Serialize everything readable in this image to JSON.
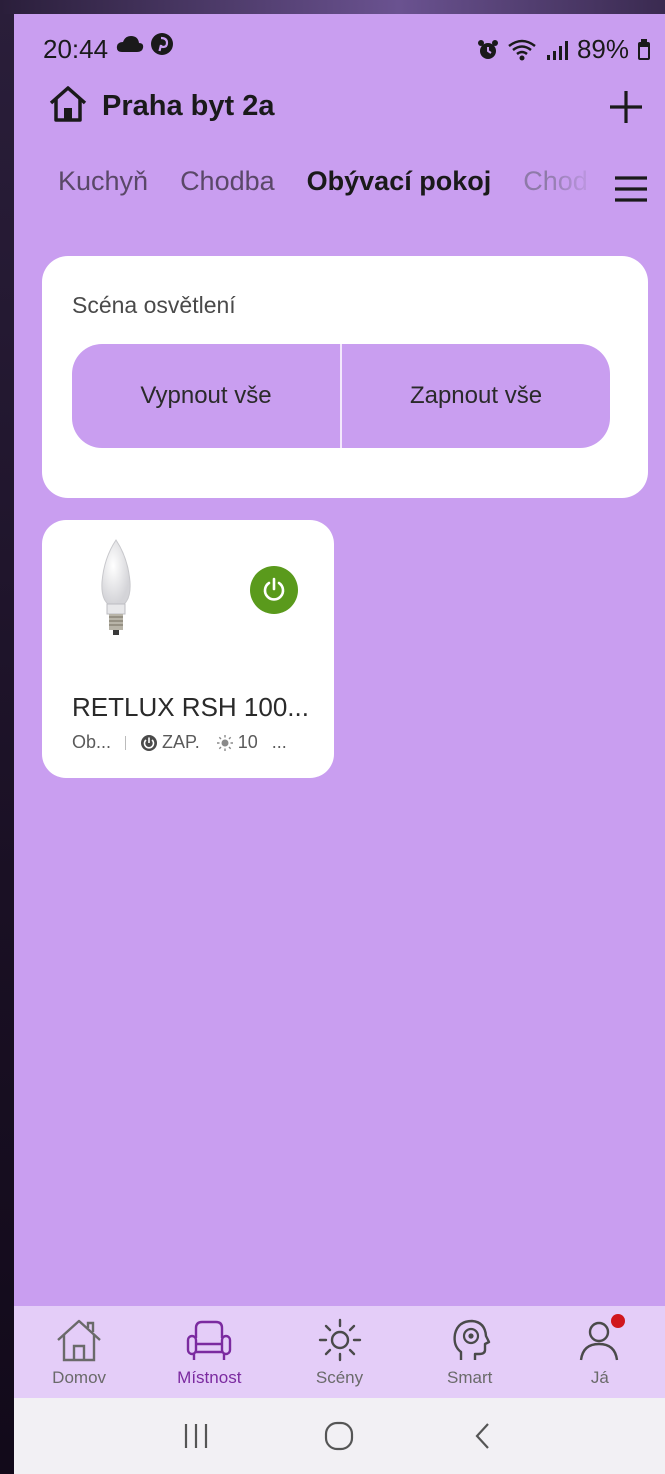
{
  "status_bar": {
    "time": "20:44",
    "battery": "89%",
    "left_icons": [
      "cloud-icon",
      "pinterest-icon"
    ],
    "right_icons": [
      "alarm-icon",
      "wifi-icon",
      "signal-icon",
      "battery-icon"
    ]
  },
  "header": {
    "title": "Praha byt 2a",
    "home_icon": "home-icon",
    "add_icon": "plus-icon"
  },
  "tabs": {
    "items": [
      {
        "label": "Kuchyň",
        "active": false
      },
      {
        "label": "Chodba",
        "active": false
      },
      {
        "label": "Obývací pokoj",
        "active": true
      },
      {
        "label": "Chod",
        "active": false
      }
    ],
    "menu_icon": "menu-icon"
  },
  "scene_card": {
    "title": "Scéna osvětlení",
    "off_all": "Vypnout vše",
    "on_all": "Zapnout vše"
  },
  "device": {
    "name": "RETLUX RSH 100...",
    "room": "Ob...",
    "state": "ZAP.",
    "brightness": "10",
    "more": "...",
    "power_on": true,
    "power_color": "#5a9a1c"
  },
  "bottom_nav": {
    "items": [
      {
        "label": "Domov",
        "icon": "home-icon",
        "active": false
      },
      {
        "label": "Místnost",
        "icon": "armchair-icon",
        "active": true
      },
      {
        "label": "Scény",
        "icon": "sun-icon",
        "active": false
      },
      {
        "label": "Smart",
        "icon": "brain-gear-icon",
        "active": false
      },
      {
        "label": "Já",
        "icon": "user-icon",
        "active": false
      }
    ]
  },
  "colors": {
    "background": "#c99ef0",
    "accent": "#7b2aa0",
    "nav_background": "#e4cdf8",
    "notification": "#d0161c"
  }
}
